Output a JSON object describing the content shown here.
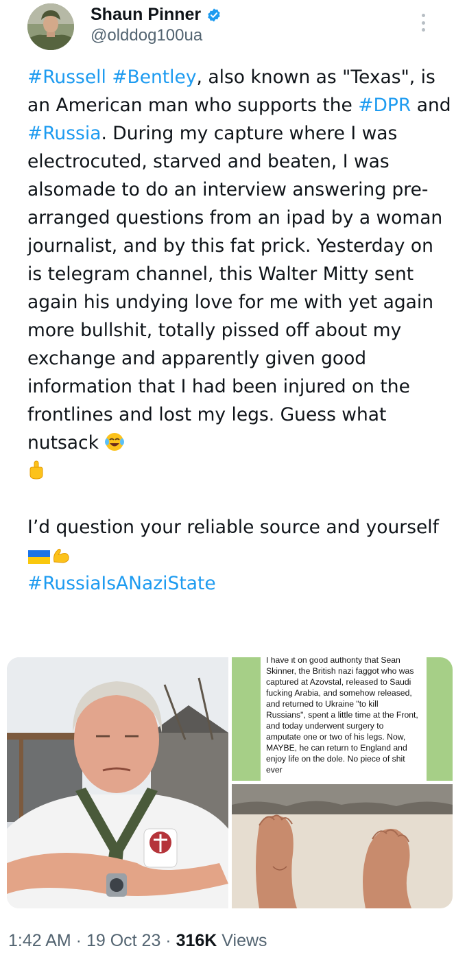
{
  "author": {
    "display_name": "Shaun Pinner",
    "handle": "@olddog100ua",
    "verified": true
  },
  "tweet": {
    "paragraph1": [
      {
        "text": "#Russell",
        "tag": true
      },
      {
        "text": " ",
        "tag": false
      },
      {
        "text": "#Bentley",
        "tag": true
      },
      {
        "text": ", also known as \"Texas\", is an American man who supports the ",
        "tag": false
      },
      {
        "text": "#DPR",
        "tag": true
      },
      {
        "text": " and ",
        "tag": false
      },
      {
        "text": "#Russia",
        "tag": true
      },
      {
        "text": ". During my capture where I was electrocuted, starved and beaten,  I was alsomade to do an interview answering pre-arranged questions from an ipad by a woman journalist, and by this fat prick. Yesterday on is telegram channel, this Walter Mitty sent again his undying love for me with yet again more bullshit, totally pissed off about my exchange and apparently given good information that I had been injured on the frontlines and lost my legs. Guess what nutsack",
        "tag": false
      }
    ],
    "paragraph2_text": "I’d question your reliable source and yourself",
    "paragraph2_tag": "#RussiaIsANaziState",
    "emojis": [
      "face-with-tears-of-joy",
      "middle-finger",
      "ukraine-flag",
      "flexed-biceps"
    ]
  },
  "media": {
    "chat_screenshot_text": "I have it on good authority that Sean Skinner, the British nazi faggot who was captured at Azovstal, released to Saudi fucking Arabia, and somehow released, and returned to Ukraine \"to kill Russians\", spent a little time at the Front, and today underwent surgery to amputate one or two of his legs. Now, MAYBE, he can return to England and enjoy life on the dole. No piece of shit ever"
  },
  "meta": {
    "time": "1:42 AM",
    "sep1": " · ",
    "date": "19 Oct 23",
    "sep2": " · ",
    "views_count": "316K",
    "views_label": " Views"
  },
  "colors": {
    "link": "#1d9bf0",
    "text": "#0f1419",
    "muted": "#536471",
    "chat_bg": "#a6cf87"
  }
}
